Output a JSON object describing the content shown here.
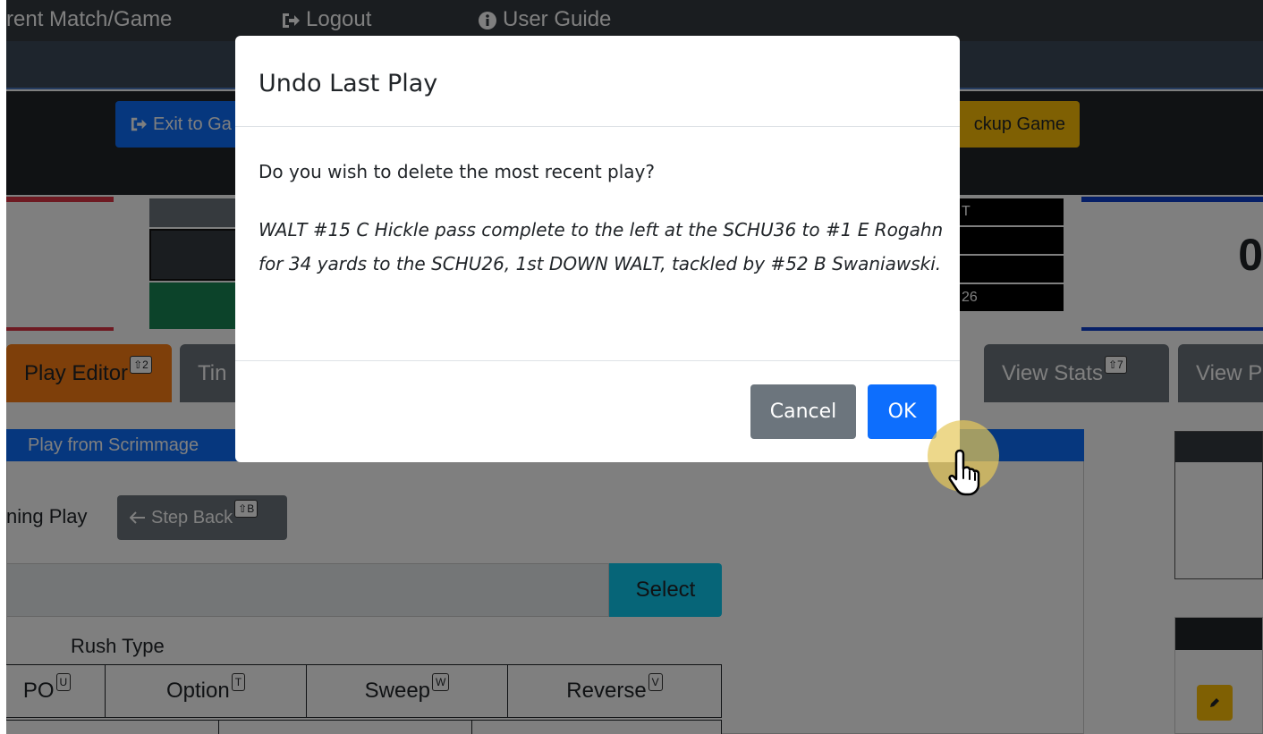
{
  "topnav": {
    "current_match": "rent Match/Game",
    "logout": "Logout",
    "user_guide": "User Guide"
  },
  "toolbar": {
    "exit_label": "Exit to Ga",
    "backup_label": "ckup Game"
  },
  "scoreboard": {
    "right_cell_1": "T",
    "right_cell_4": "26",
    "home_score": "0"
  },
  "tabs": [
    {
      "label": "Play Editor",
      "shortcut": "⇧2"
    },
    {
      "label": "Tin",
      "shortcut": ""
    },
    {
      "label": "View Stats",
      "shortcut": "⇧7"
    },
    {
      "label": "View P",
      "shortcut": ""
    }
  ],
  "panel": {
    "header": "Play from Scrimmage",
    "mid_label": "ning Play",
    "step_back": "Step Back",
    "step_back_shortcut": "⇧B",
    "select": "Select",
    "rush_type_label": "Rush Type",
    "rush_options": [
      {
        "label": "PO",
        "shortcut": "U"
      },
      {
        "label": "Option",
        "shortcut": "T"
      },
      {
        "label": "Sweep",
        "shortcut": "W"
      },
      {
        "label": "Reverse",
        "shortcut": "V"
      }
    ]
  },
  "modal": {
    "title": "Undo Last Play",
    "question": "Do you wish to delete the most recent play?",
    "description": "WALT #15 C Hickle pass complete to the left at the SCHU36 to #1 E Rogahn for 34 yards to the SCHU26, 1st DOWN WALT, tackled by #52 B Swaniawski.",
    "cancel_label": "Cancel",
    "ok_label": "OK"
  },
  "colors": {
    "primary": "#0d6efd",
    "secondary": "#6c757d",
    "warning": "#ffc107",
    "active_tab": "#fd7e14",
    "info": "#0dcaf0"
  },
  "icons": [
    "sign-out-icon",
    "info-circle-icon",
    "arrow-left-icon",
    "pencil-icon",
    "pointer-hand-icon"
  ]
}
